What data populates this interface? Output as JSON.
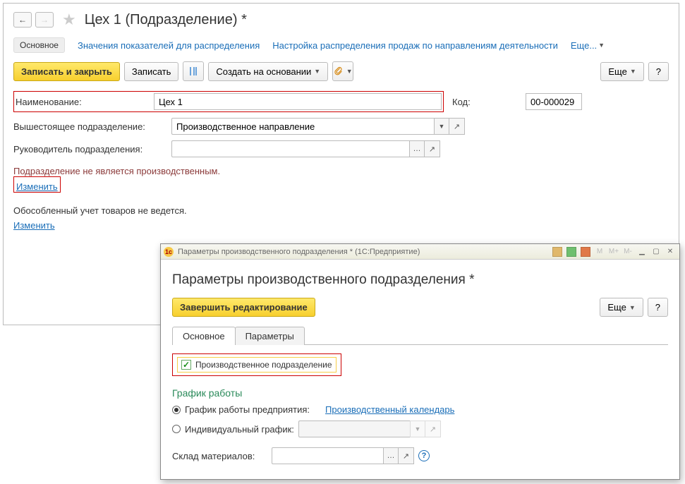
{
  "main": {
    "title": "Цех 1 (Подразделение) *",
    "navTabs": {
      "active": "Основное",
      "link1": "Значения показателей для распределения",
      "link2": "Настройка распределения продаж по направлениям деятельности",
      "more": "Еще..."
    },
    "toolbar": {
      "save_close": "Записать и закрыть",
      "save": "Записать",
      "create_based": "Создать на основании",
      "more": "Еще",
      "help": "?"
    },
    "form": {
      "name_label": "Наименование:",
      "name_value": "Цех 1",
      "code_label": "Код:",
      "code_value": "00-000029",
      "parent_label": "Вышестоящее подразделение:",
      "parent_value": "Производственное направление",
      "manager_label": "Руководитель подразделения:",
      "manager_value": ""
    },
    "status1": "Подразделение не является производственным.",
    "change1": "Изменить",
    "status2": "Обособленный учет товаров не ведется.",
    "change2": "Изменить"
  },
  "modal": {
    "winTitle": "Параметры производственного подразделения * (1С:Предприятие)",
    "title": "Параметры производственного подразделения *",
    "toolbar": {
      "finish": "Завершить редактирование",
      "more": "Еще",
      "help": "?"
    },
    "tabs": {
      "t1": "Основное",
      "t2": "Параметры"
    },
    "checkbox_label": "Производственное подразделение",
    "schedule_title": "График работы",
    "radio1": "График работы предприятия:",
    "calendar_link": "Производственный календарь",
    "radio2": "Индивидуальный график:",
    "warehouse_label": "Склад материалов:"
  }
}
